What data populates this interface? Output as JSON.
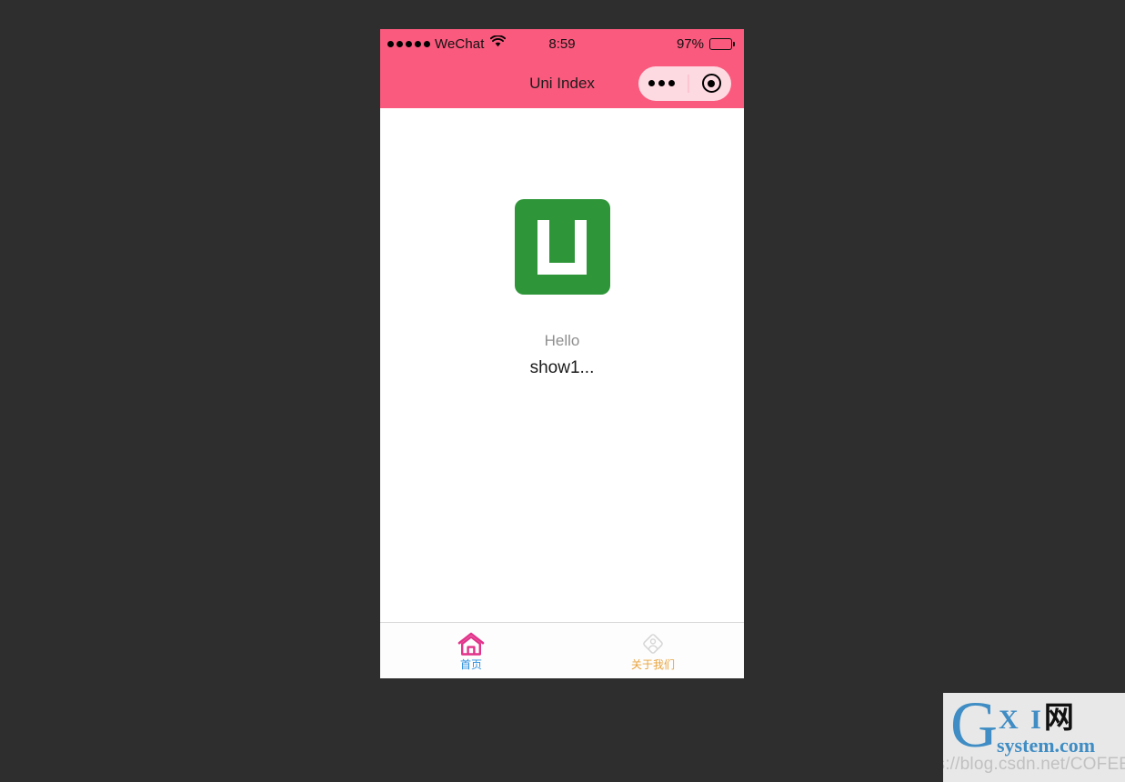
{
  "device": {
    "status_bar": {
      "carrier": "WeChat",
      "signal_dots": 5,
      "wifi_icon": "wifi-icon",
      "time": "8:59",
      "battery_percent": "97%",
      "battery_level": 97
    },
    "nav_bar": {
      "title": "Uni Index",
      "capsule": {
        "menu_icon": "ellipsis-icon",
        "close_icon": "target-circle-icon"
      }
    }
  },
  "page": {
    "logo": {
      "icon": "uni-app-logo-icon",
      "color": "#2E9639"
    },
    "greeting": "Hello",
    "title": "show1..."
  },
  "tab_bar": {
    "items": [
      {
        "label": "首页",
        "icon": "home-icon",
        "icon_color": "#E2338A",
        "label_color": "#2B8FE0",
        "active": true
      },
      {
        "label": "关于我们",
        "icon": "user-diamond-icon",
        "icon_color": "#D5D5D5",
        "label_color": "#E8A33D",
        "active": false
      }
    ]
  },
  "watermark": {
    "logo_g": "G",
    "logo_xi": "X I",
    "logo_cn": "网",
    "logo_system": "system.com",
    "url": "https://blog.csdn.net/COFEECR"
  },
  "colors": {
    "header_pink": "#FA5A7D",
    "capsule_pink": "#FDD9E1",
    "page_background": "#FFFFFF",
    "desktop_background": "#2E2E2E",
    "logo_green": "#2E9639"
  }
}
